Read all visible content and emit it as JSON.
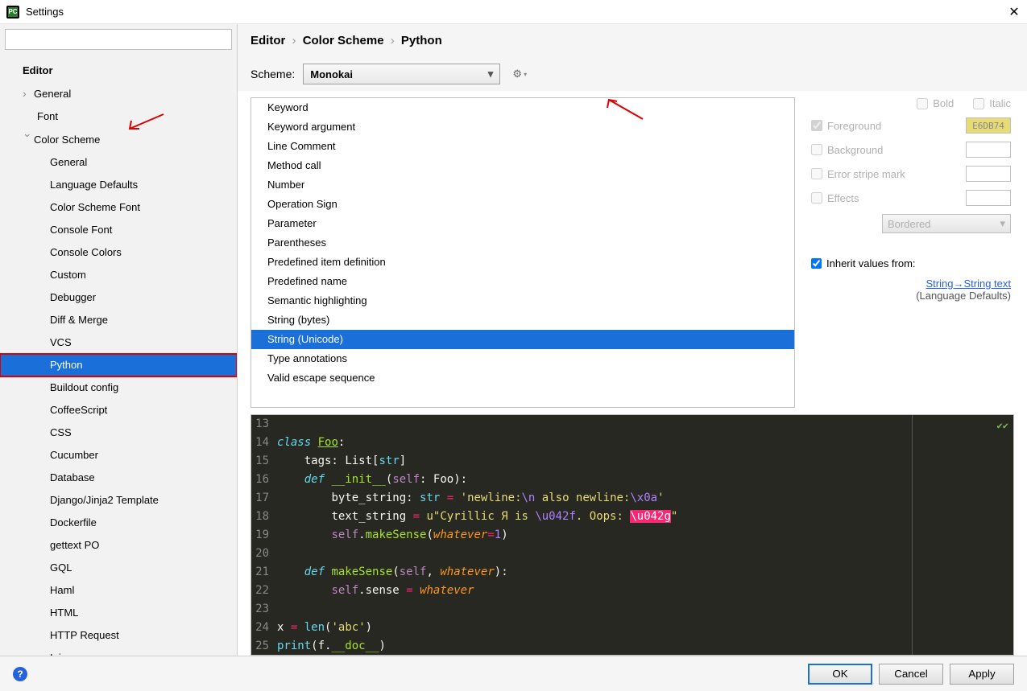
{
  "window": {
    "title": "Settings"
  },
  "sidebar": {
    "items": [
      {
        "label": "Editor",
        "level": 1
      },
      {
        "label": "General",
        "level": 2,
        "expandable": true
      },
      {
        "label": "Font",
        "level": 2
      },
      {
        "label": "Color Scheme",
        "level": 2,
        "expanded": true
      },
      {
        "label": "General",
        "level": 3
      },
      {
        "label": "Language Defaults",
        "level": 3
      },
      {
        "label": "Color Scheme Font",
        "level": 3
      },
      {
        "label": "Console Font",
        "level": 3
      },
      {
        "label": "Console Colors",
        "level": 3
      },
      {
        "label": "Custom",
        "level": 3
      },
      {
        "label": "Debugger",
        "level": 3
      },
      {
        "label": "Diff & Merge",
        "level": 3
      },
      {
        "label": "VCS",
        "level": 3
      },
      {
        "label": "Python",
        "level": 3,
        "selected": true,
        "redbox": true
      },
      {
        "label": "Buildout config",
        "level": 3
      },
      {
        "label": "CoffeeScript",
        "level": 3
      },
      {
        "label": "CSS",
        "level": 3
      },
      {
        "label": "Cucumber",
        "level": 3
      },
      {
        "label": "Database",
        "level": 3
      },
      {
        "label": "Django/Jinja2 Template",
        "level": 3
      },
      {
        "label": "Dockerfile",
        "level": 3
      },
      {
        "label": "gettext PO",
        "level": 3
      },
      {
        "label": "GQL",
        "level": 3
      },
      {
        "label": "Haml",
        "level": 3
      },
      {
        "label": "HTML",
        "level": 3
      },
      {
        "label": "HTTP Request",
        "level": 3
      },
      {
        "label": "Ini",
        "level": 3
      }
    ]
  },
  "breadcrumb": {
    "p1": "Editor",
    "p2": "Color Scheme",
    "p3": "Python"
  },
  "scheme": {
    "label": "Scheme:",
    "value": "Monokai"
  },
  "syntax_items": [
    "Keyword",
    "Keyword argument",
    "Line Comment",
    "Method call",
    "Number",
    "Operation Sign",
    "Parameter",
    "Parentheses",
    "Predefined item definition",
    "Predefined name",
    "Semantic highlighting",
    "String (bytes)",
    "String (Unicode)",
    "Type annotations",
    "Valid escape sequence"
  ],
  "syntax_selected": "String (Unicode)",
  "options": {
    "bold": "Bold",
    "italic": "Italic",
    "foreground": "Foreground",
    "foreground_value": "E6DB74",
    "background": "Background",
    "error_stripe": "Error stripe mark",
    "effects": "Effects",
    "effects_type": "Bordered",
    "inherit_label": "Inherit values from:",
    "inherit_link": "String→String text",
    "inherit_sub": "(Language Defaults)"
  },
  "preview_lines": [
    13,
    14,
    15,
    16,
    17,
    18,
    19,
    20,
    21,
    22,
    23,
    24,
    25
  ],
  "buttons": {
    "ok": "OK",
    "cancel": "Cancel",
    "apply": "Apply"
  }
}
